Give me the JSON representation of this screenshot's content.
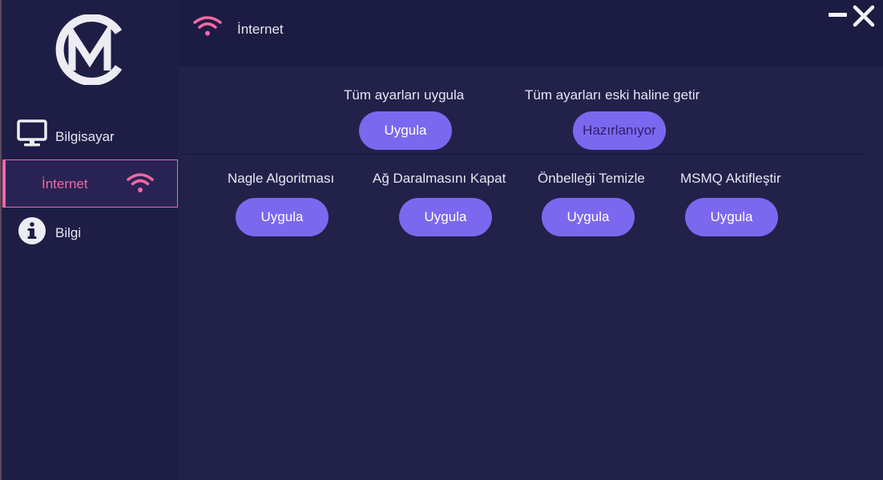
{
  "app": {
    "brand_initials": "CM"
  },
  "sidebar": {
    "items": [
      {
        "label": "Bilgisayar",
        "icon": "monitor-icon"
      },
      {
        "label": "İnternet",
        "icon": "wifi-icon",
        "active": true
      },
      {
        "label": "Bilgi",
        "icon": "info-icon"
      }
    ]
  },
  "header": {
    "title": "İnternet",
    "icon": "wifi-icon"
  },
  "window": {
    "minimize_icon": "minimize-icon",
    "close_icon": "close-icon"
  },
  "main": {
    "bulk": [
      {
        "caption": "Tüm ayarları uygula",
        "button": "Uygula"
      },
      {
        "caption": "Tüm ayarları eski haline getir",
        "button": "Hazırlanıyor"
      }
    ],
    "tweaks": [
      {
        "caption": "Nagle Algoritması",
        "button": "Uygula"
      },
      {
        "caption": "Ağ Daralmasını Kapat",
        "button": "Uygula"
      },
      {
        "caption": "Önbelleği Temizle",
        "button": "Uygula"
      },
      {
        "caption": "MSMQ Aktifleştir",
        "button": "Uygula"
      }
    ]
  },
  "colors": {
    "accent": "#7b68ee",
    "highlight": "#f06aa4",
    "sidebar_bg": "#1e1d45",
    "main_bg": "#22214a"
  }
}
